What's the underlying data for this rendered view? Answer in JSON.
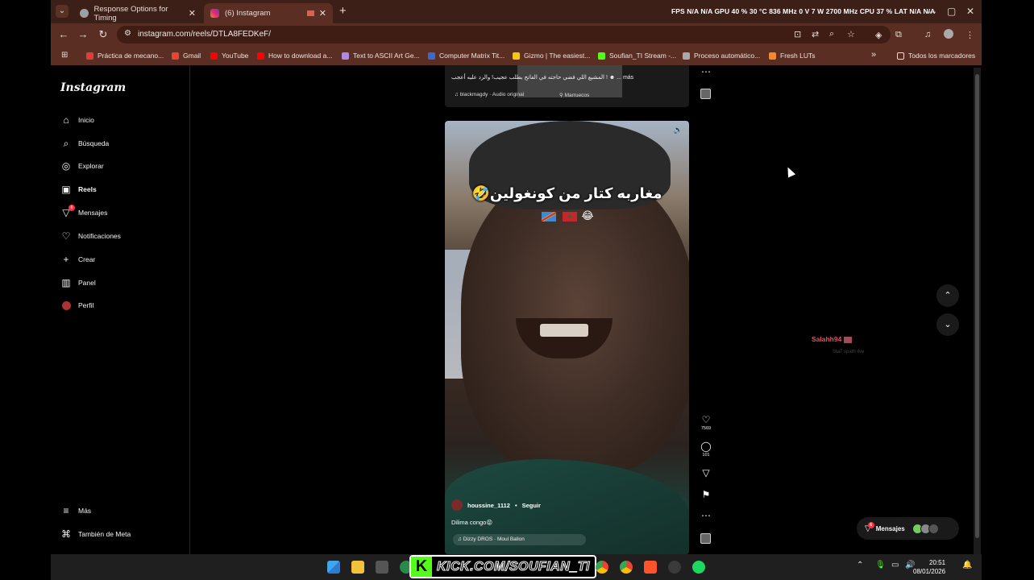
{
  "tabs": [
    {
      "title": "Response Options for Timing",
      "close": "✕"
    },
    {
      "title": "(6) Instagram",
      "close": "✕"
    }
  ],
  "new_tab": "+",
  "sysstats": "FPS  N/A  N/A     GPU 40 %  30 °C  836 MHz   0 V   7 W  2700 MHz     CPU  37 %      LAT  N/A  N/A",
  "window_controls": {
    "minimize": "—",
    "maximize": "▢",
    "close": "✕"
  },
  "address": {
    "url": "instagram.com/reels/DTLA8FEDKeF/"
  },
  "bookmarks": [
    {
      "label": "Práctica de mecano...",
      "color": "#e03c3c"
    },
    {
      "label": "Gmail",
      "color": "#ea4335"
    },
    {
      "label": "YouTube",
      "color": "#ff0000"
    },
    {
      "label": "How to download a...",
      "color": "#ff0000"
    },
    {
      "label": "Text to ASCII Art Ge...",
      "color": "#b08ae0"
    },
    {
      "label": "Computer Matrix Tit...",
      "color": "#3a6ad0"
    },
    {
      "label": "Gizmo | The easiest...",
      "color": "#f5c518"
    },
    {
      "label": "Soufian_TI Stream -...",
      "color": "#53fc18"
    },
    {
      "label": "Proceso automático...",
      "color": "#aaaaaa"
    },
    {
      "label": "Fresh LUTs",
      "color": "#f08a30"
    }
  ],
  "bookmarks_more": "»",
  "all_bookmarks": "Todos los marcadores",
  "instagram": {
    "logo": "Instagram",
    "nav": [
      {
        "label": "Inicio",
        "icon": "home-icon"
      },
      {
        "label": "Búsqueda",
        "icon": "search-icon"
      },
      {
        "label": "Explorar",
        "icon": "compass-icon"
      },
      {
        "label": "Reels",
        "icon": "reels-icon"
      },
      {
        "label": "Mensajes",
        "icon": "messenger-icon",
        "badge": "6"
      },
      {
        "label": "Notificaciones",
        "icon": "heart-icon"
      },
      {
        "label": "Crear",
        "icon": "plus-icon"
      },
      {
        "label": "Panel",
        "icon": "dashboard-icon"
      },
      {
        "label": "Perfil",
        "icon": "avatar-icon"
      }
    ],
    "more": "Más",
    "meta": "También de Meta"
  },
  "prev_reel": {
    "caption": "المشيع اللي فضي حاجته في الفاتح بطلب عجيب! والرد عليه أعجب ! ☻ ... más",
    "audio": "blackmagdy · Audio original",
    "location": "Marruecos"
  },
  "reel": {
    "caption_ar": "مغاربه كتار من كونغولين🤣",
    "emoji": "😂",
    "author": "houssine_1112",
    "follow": "Seguir",
    "caption": "Dilima congo😝",
    "audio": "Dizzy DROS · Moul Ballon",
    "likes": "7569",
    "comments": "101"
  },
  "suggestion": {
    "name": "Salahh94",
    "sub": "Sta7 spath live"
  },
  "messages_pill": {
    "label": "Mensajes",
    "badge": "6"
  },
  "kick": {
    "label": "KICK.COM/SOUFIAN_TI"
  },
  "clock": {
    "time": "20:51",
    "date": "08/01/2026"
  }
}
